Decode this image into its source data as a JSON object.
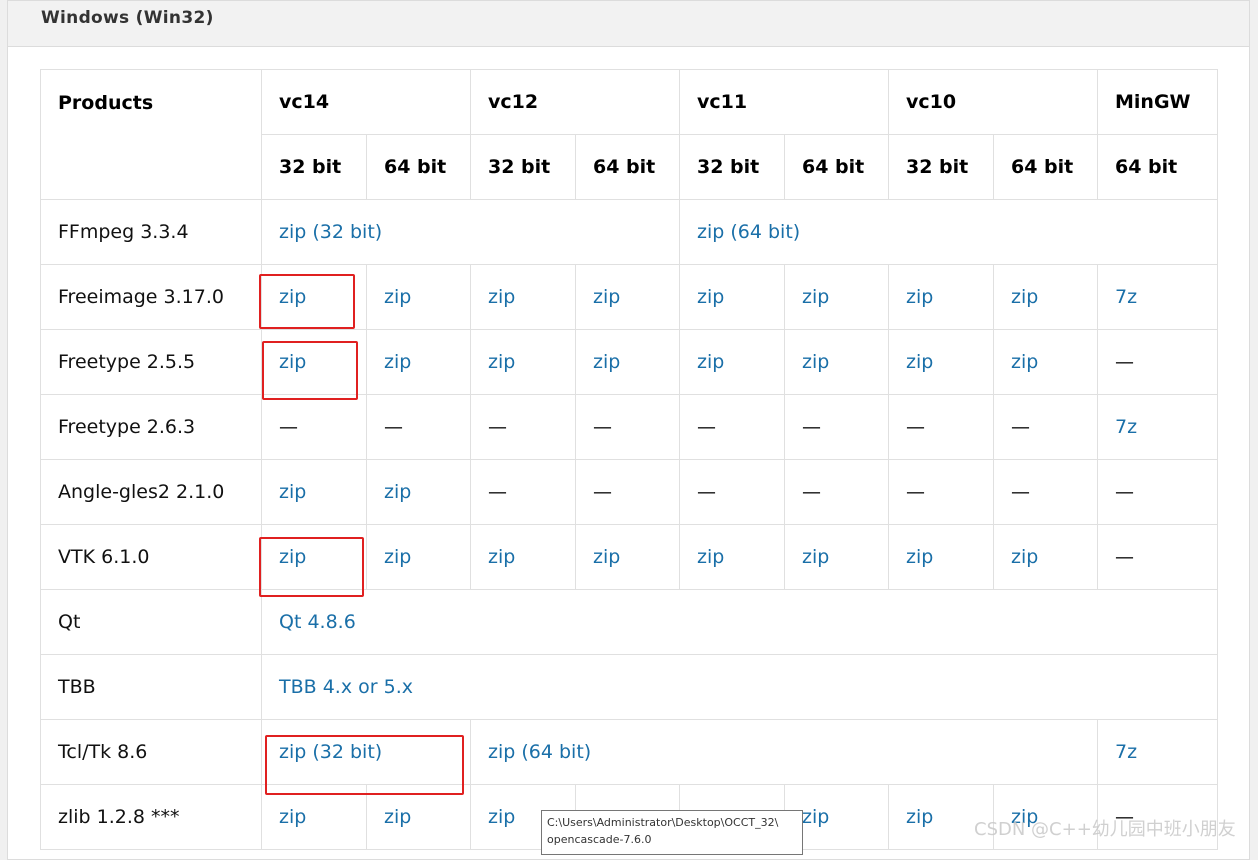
{
  "section_title": "Windows (Win32)",
  "header": {
    "products": "Products",
    "compilers": [
      "vc14",
      "vc12",
      "vc11",
      "vc10",
      "MinGW"
    ],
    "bits": [
      "32 bit",
      "64 bit",
      "32 bit",
      "64 bit",
      "32 bit",
      "64 bit",
      "32 bit",
      "64 bit",
      "64 bit"
    ]
  },
  "rows": {
    "ffmpeg": {
      "name": "FFmpeg 3.3.4",
      "link32": "zip (32 bit)",
      "link64": "zip (64 bit)"
    },
    "freeimage": {
      "name": "Freeimage 3.17.0",
      "cells": [
        "zip",
        "zip",
        "zip",
        "zip",
        "zip",
        "zip",
        "zip",
        "zip",
        "7z"
      ]
    },
    "freetype255": {
      "name": "Freetype 2.5.5",
      "cells": [
        "zip",
        "zip",
        "zip",
        "zip",
        "zip",
        "zip",
        "zip",
        "zip",
        "—"
      ]
    },
    "freetype263": {
      "name": "Freetype 2.6.3",
      "cells": [
        "—",
        "—",
        "—",
        "—",
        "—",
        "—",
        "—",
        "—",
        "7z"
      ]
    },
    "angle": {
      "name": "Angle-gles2 2.1.0",
      "cells": [
        "zip",
        "zip",
        "—",
        "—",
        "—",
        "—",
        "—",
        "—",
        "—"
      ]
    },
    "vtk": {
      "name": "VTK 6.1.0",
      "cells": [
        "zip",
        "zip",
        "zip",
        "zip",
        "zip",
        "zip",
        "zip",
        "zip",
        "—"
      ]
    },
    "qt": {
      "name": "Qt",
      "link": "Qt 4.8.6"
    },
    "tbb": {
      "name": "TBB",
      "link": "TBB 4.x or 5.x"
    },
    "tcltk": {
      "name": "Tcl/Tk 8.6",
      "link32": "zip (32 bit)",
      "link64": "zip (64 bit)",
      "mingw": "7z"
    },
    "zlib": {
      "name": "zlib 1.2.8 ***",
      "cells": [
        "zip",
        "zip",
        "zip",
        "",
        "",
        "zip",
        "zip",
        "zip",
        "—"
      ]
    }
  },
  "tooltip": {
    "line1": "C:\\Users\\Administrator\\Desktop\\OCCT_32\\",
    "line2": "opencascade-7.6.0"
  },
  "watermark": "CSDN @C++幼儿园中班小朋友",
  "colors": {
    "link": "#1a6fa8",
    "highlight": "#e02020",
    "header_bg": "#f2f2f2"
  }
}
